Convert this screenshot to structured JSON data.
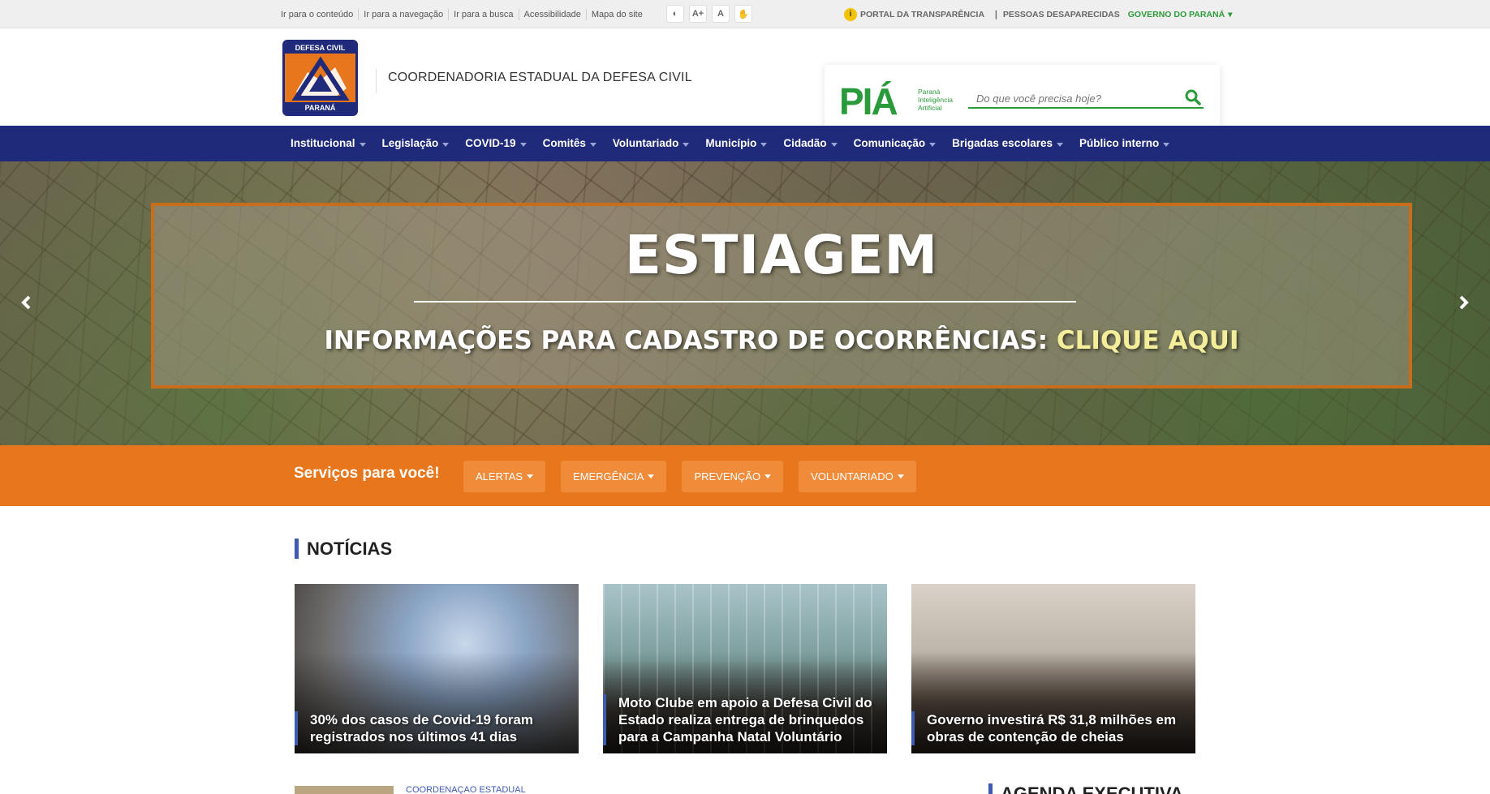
{
  "topbar": {
    "skip_links": [
      "Ir para o conteúdo",
      "Ir para a navegação",
      "Ir para a busca",
      "Acessibilidade",
      "Mapa do site"
    ],
    "a11y_buttons": [
      "◐",
      "A+",
      "A",
      "✋"
    ],
    "transparency": "PORTAL DA TRANSPARÊNCIA",
    "missing": "PESSOAS DESAPARECIDAS",
    "government": "GOVERNO DO PARANÁ"
  },
  "header": {
    "logo_top": "DEFESA CIVIL",
    "logo_bottom": "PARANÁ",
    "org_name": "COORDENADORIA ESTADUAL DA DEFESA CIVIL",
    "pia_logo": "PIÁ",
    "pia_sub": [
      "Paraná",
      "Inteligência",
      "Artificial"
    ],
    "search_placeholder": "Do que você precisa hoje?"
  },
  "nav": {
    "items": [
      "Institucional",
      "Legislação",
      "COVID-19",
      "Comitês",
      "Voluntariado",
      "Município",
      "Cidadão",
      "Comunicação",
      "Brigadas escolares",
      "Público interno"
    ]
  },
  "hero": {
    "headline": "ESTIAGEM",
    "subline": "INFORMAÇÕES PARA CADASTRO DE OCORRÊNCIAS:",
    "cta": "CLIQUE AQUI"
  },
  "services": {
    "title": "Serviços para você!",
    "buttons": [
      "ALERTAS",
      "EMERGÊNCIA",
      "PREVENÇÃO",
      "VOLUNTARIADO"
    ]
  },
  "news": {
    "title": "NOTÍCIAS",
    "cards": [
      {
        "caption": "30% dos casos de Covid-19 foram registrados nos últimos 41 dias"
      },
      {
        "caption": "Moto Clube em apoio a Defesa Civil do Estado realiza entrega de brinquedos para a Campanha Natal Voluntário"
      },
      {
        "caption": "Governo investirá R$ 31,8 milhões em obras de contenção de cheias"
      }
    ],
    "next_tag": "COORDENAÇÃO ESTADUAL",
    "agenda_title": "AGENDA EXECUTIVA"
  },
  "colors": {
    "nav_blue": "#1f2b7a",
    "orange": "#e8761c",
    "green": "#2a9b3b",
    "accent_blue": "#3e5bb3"
  }
}
